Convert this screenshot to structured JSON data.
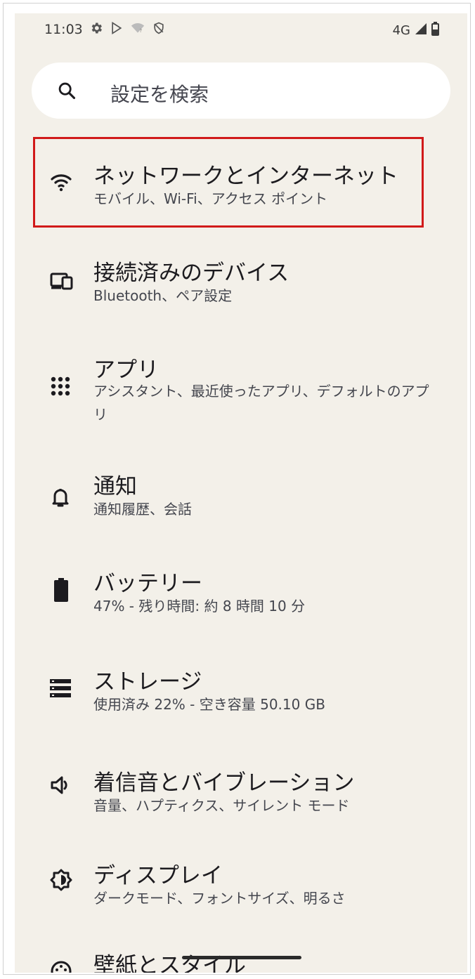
{
  "status_bar": {
    "time": "11:03",
    "network": "4G",
    "left_icons": [
      "gear-icon",
      "play-store-icon",
      "wifi-off-icon",
      "shield-icon"
    ],
    "right_icons": [
      "signal-icon",
      "battery-icon"
    ]
  },
  "search": {
    "placeholder": "設定を検索",
    "icon": "search-icon"
  },
  "settings": {
    "items": [
      {
        "title": "ネットワークとインターネット",
        "subtitle": "モバイル、Wi-Fi、アクセス ポイント",
        "icon": "wifi-icon",
        "highlighted": true
      },
      {
        "title": "接続済みのデバイス",
        "subtitle": "Bluetooth、ペア設定",
        "icon": "devices-icon"
      },
      {
        "title": "アプリ",
        "subtitle": "アシスタント、最近使ったアプリ、デフォルトのアプリ",
        "icon": "apps-grid-icon"
      },
      {
        "title": "通知",
        "subtitle": "通知履歴、会話",
        "icon": "bell-icon"
      },
      {
        "title": "バッテリー",
        "subtitle": "47% - 残り時間: 約 8 時間 10 分",
        "icon": "battery-icon"
      },
      {
        "title": "ストレージ",
        "subtitle": "使用済み 22% - 空き容量 50.10 GB",
        "icon": "storage-icon"
      },
      {
        "title": "着信音とバイブレーション",
        "subtitle": "音量、ハプティクス、サイレント モード",
        "icon": "volume-icon"
      },
      {
        "title": "ディスプレイ",
        "subtitle": "ダークモード、フォントサイズ、明るさ",
        "icon": "display-icon"
      },
      {
        "title": "壁紙とスタイル",
        "subtitle": "",
        "icon": "palette-icon"
      }
    ]
  },
  "colors": {
    "background": "#f3f0e9",
    "highlight_border": "#d11a1a",
    "text_primary": "#1c1b1f",
    "text_secondary": "#44464e"
  }
}
